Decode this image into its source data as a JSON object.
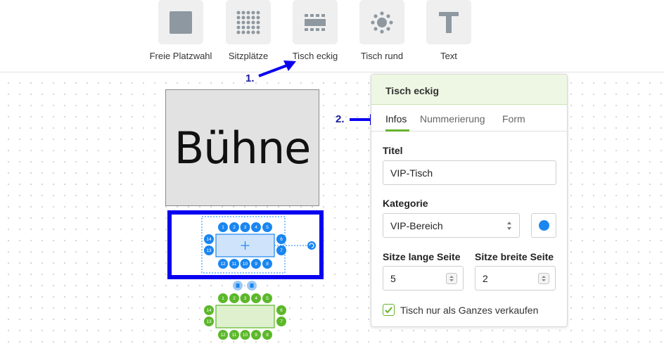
{
  "toolbar": {
    "tools": [
      {
        "label": "Freie Platzwahl",
        "icon": "free-seating-icon"
      },
      {
        "label": "Sitzplätze",
        "icon": "seats-grid-icon"
      },
      {
        "label": "Tisch eckig",
        "icon": "rectangular-table-icon"
      },
      {
        "label": "Tisch rund",
        "icon": "round-table-icon"
      },
      {
        "label": "Text",
        "icon": "text-icon"
      }
    ]
  },
  "annotations": {
    "step1": "1.",
    "step2": "2.",
    "arrow_color": "#0a00f0"
  },
  "canvas": {
    "stage_label": "Bühne",
    "selected_table": {
      "top_seats": [
        "1",
        "2",
        "3",
        "4",
        "5"
      ],
      "bottom_seats": [
        "12",
        "11",
        "10",
        "9",
        "8"
      ],
      "left_seats": [
        "14",
        "13"
      ],
      "right_seats": [
        "6",
        "7"
      ],
      "color": "#1a86f0"
    },
    "second_table": {
      "top_seats": [
        "1",
        "2",
        "3",
        "4",
        "5"
      ],
      "bottom_seats": [
        "12",
        "11",
        "10",
        "9",
        "8"
      ],
      "left_seats": [
        "14",
        "13"
      ],
      "right_seats": [
        "6",
        "7"
      ],
      "color": "#5cb82a"
    }
  },
  "panel": {
    "title": "Tisch eckig",
    "tabs": [
      "Infos",
      "Nummerierung",
      "Form"
    ],
    "active_tab": "Infos",
    "title_label": "Titel",
    "title_value": "VIP-Tisch",
    "category_label": "Kategorie",
    "category_value": "VIP-Bereich",
    "category_color": "#1a86f0",
    "long_side_label": "Sitze lange Seite",
    "long_side_value": "5",
    "short_side_label": "Sitze breite Seite",
    "short_side_value": "2",
    "checkbox_label": "Tisch nur als Ganzes verkaufen",
    "checkbox_checked": true,
    "accent": "#66b32e"
  }
}
